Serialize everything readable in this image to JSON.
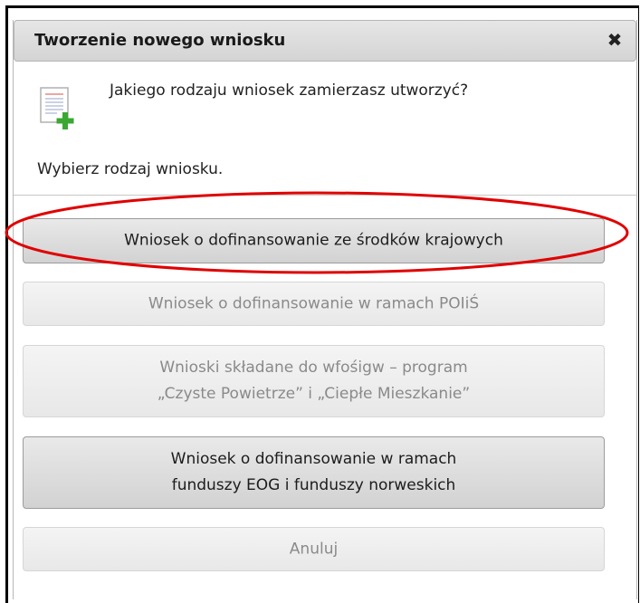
{
  "dialog": {
    "title": "Tworzenie nowego wniosku",
    "close_icon": "close-icon",
    "question": "Jakiego rodzaju wniosek zamierzasz utworzyć?",
    "instruction": "Wybierz rodzaj wniosku."
  },
  "options": [
    {
      "lines": [
        "Wniosek o dofinansowanie ze środków krajowych"
      ],
      "state": "enabled"
    },
    {
      "lines": [
        "Wniosek o dofinansowanie w ramach POIiŚ"
      ],
      "state": "disabled"
    },
    {
      "lines": [
        "Wnioski składane do wfośigw – program",
        "„Czyste Powietrze” i „Ciepłe Mieszkanie”"
      ],
      "state": "disabled"
    },
    {
      "lines": [
        "Wniosek o dofinansowanie w ramach",
        "funduszy EOG i funduszy norweskich"
      ],
      "state": "enabled"
    },
    {
      "lines": [
        "Anuluj"
      ],
      "state": "disabled"
    }
  ],
  "colors": {
    "highlight": "#e00000",
    "icon_plus": "#3aa832"
  }
}
